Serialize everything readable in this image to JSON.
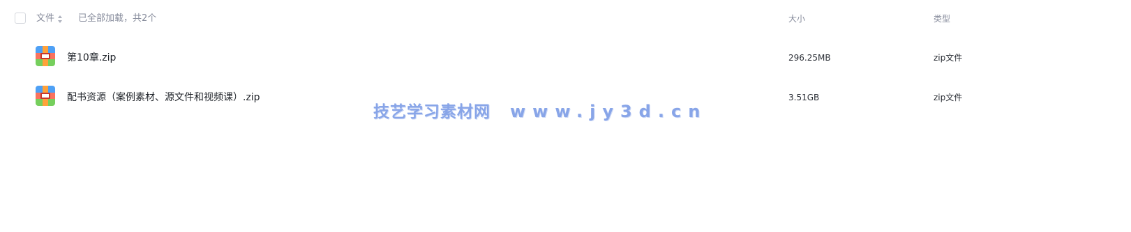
{
  "header": {
    "name_label": "文件",
    "status_text": "已全部加载，共2个",
    "size_label": "大小",
    "type_label": "类型"
  },
  "files": [
    {
      "name": "第10章.zip",
      "size": "296.25MB",
      "type": "zip文件",
      "icon": "zip-archive-icon"
    },
    {
      "name": "配书资源（案例素材、源文件和视频课）.zip",
      "size": "3.51GB",
      "type": "zip文件",
      "icon": "zip-archive-icon"
    }
  ],
  "watermark": {
    "text_cn": "技艺学习素材网",
    "text_url": "www.jy3d.cn",
    "color": "#7c9ce6"
  },
  "icons": {
    "sort": "sort-arrows-icon",
    "select_all": "checkbox"
  }
}
